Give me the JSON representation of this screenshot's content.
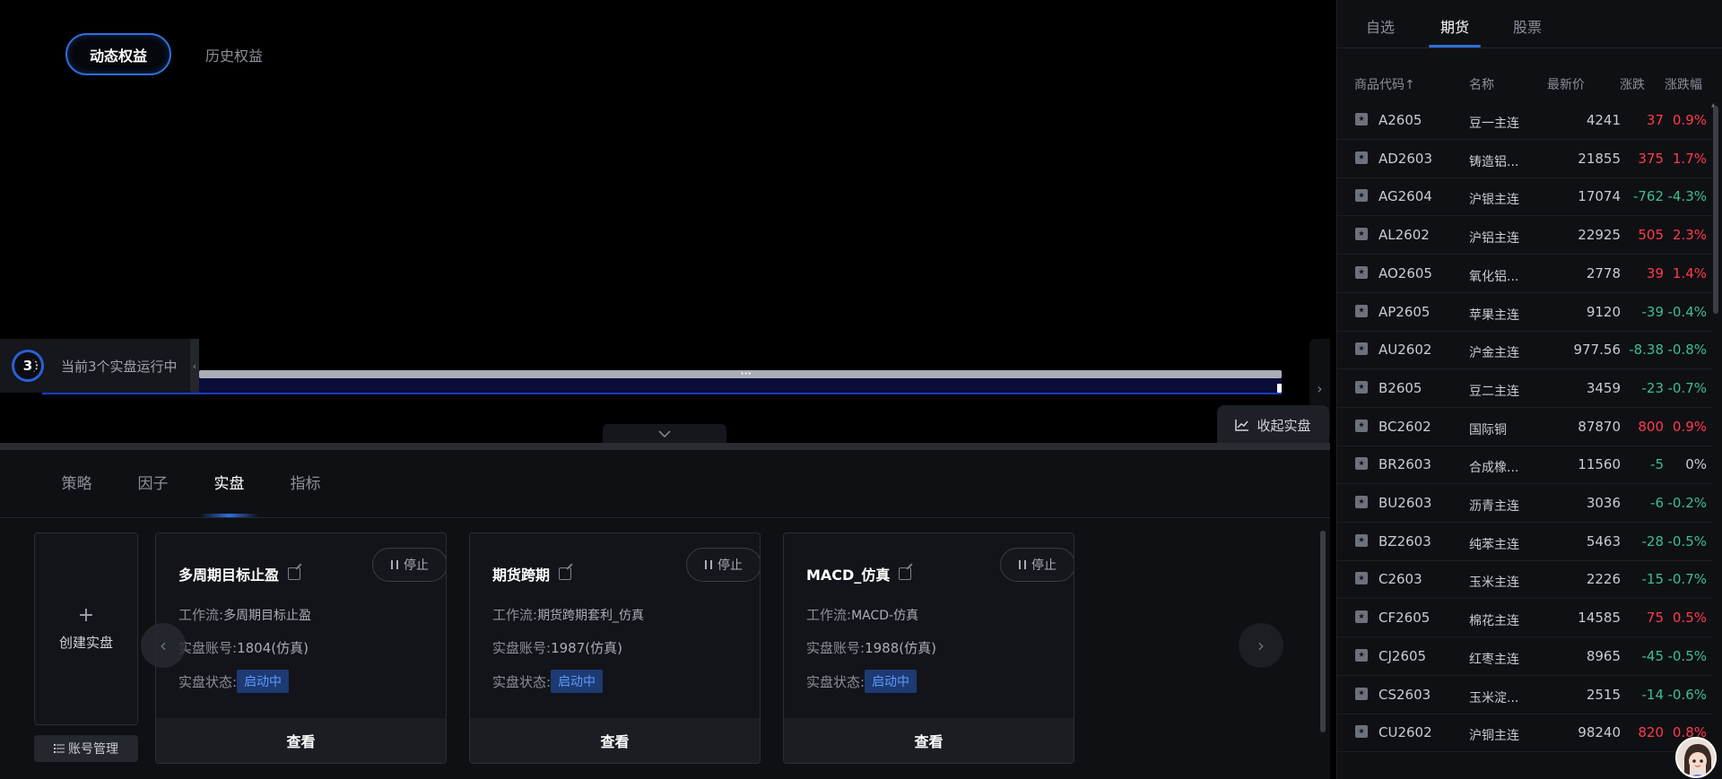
{
  "equity_tabs": [
    {
      "label": "动态权益",
      "active": true
    },
    {
      "label": "历史权益",
      "active": false
    }
  ],
  "running": {
    "count": "3",
    "text": "当前3个实盘运行中"
  },
  "collapse_live_label": "收起实盘",
  "bottom_tabs": [
    {
      "label": "策略",
      "active": false
    },
    {
      "label": "因子",
      "active": false
    },
    {
      "label": "实盘",
      "active": true
    },
    {
      "label": "指标",
      "active": false
    }
  ],
  "create_card": {
    "plus": "+",
    "label": "创建实盘"
  },
  "account_button": {
    "icon": "list-icon",
    "label": "账号管理"
  },
  "live_cards": [
    {
      "title": "多周期目标止盈",
      "stop": "停止",
      "workflow_label": "工作流:",
      "workflow": "多周期目标止盈",
      "account_label": "实盘账号:",
      "account": "1804(仿真)",
      "status_label": "实盘状态:",
      "status": "启动中",
      "view": "查看"
    },
    {
      "title": "期货跨期",
      "stop": "停止",
      "workflow_label": "工作流:",
      "workflow": "期货跨期套利_仿真",
      "account_label": "实盘账号:",
      "account": "1987(仿真)",
      "status_label": "实盘状态:",
      "status": "启动中",
      "view": "查看"
    },
    {
      "title": "MACD_仿真",
      "stop": "停止",
      "workflow_label": "工作流:",
      "workflow": "MACD-仿真",
      "account_label": "实盘账号:",
      "account": "1988(仿真)",
      "status_label": "实盘状态:",
      "status": "启动中",
      "view": "查看"
    }
  ],
  "right_tabs": [
    {
      "label": "自选",
      "active": false
    },
    {
      "label": "期货",
      "active": true
    },
    {
      "label": "股票",
      "active": false
    }
  ],
  "quote_headers": {
    "code": "商品代码↑",
    "name": "名称",
    "price": "最新价",
    "chg": "涨跌",
    "pct": "涨跌幅"
  },
  "quotes": [
    {
      "code": "A2605",
      "name": "豆一主连",
      "price": "4241",
      "chg": "37",
      "pct": "0.9%",
      "dir": "up"
    },
    {
      "code": "AD2603",
      "name": "铸造铝...",
      "price": "21855",
      "chg": "375",
      "pct": "1.7%",
      "dir": "up"
    },
    {
      "code": "AG2604",
      "name": "沪银主连",
      "price": "17074",
      "chg": "-762",
      "pct": "-4.3%",
      "dir": "down"
    },
    {
      "code": "AL2602",
      "name": "沪铝主连",
      "price": "22925",
      "chg": "505",
      "pct": "2.3%",
      "dir": "up"
    },
    {
      "code": "AO2605",
      "name": "氧化铝...",
      "price": "2778",
      "chg": "39",
      "pct": "1.4%",
      "dir": "up"
    },
    {
      "code": "AP2605",
      "name": "苹果主连",
      "price": "9120",
      "chg": "-39",
      "pct": "-0.4%",
      "dir": "down"
    },
    {
      "code": "AU2602",
      "name": "沪金主连",
      "price": "977.56",
      "chg": "-8.38",
      "pct": "-0.8%",
      "dir": "down"
    },
    {
      "code": "B2605",
      "name": "豆二主连",
      "price": "3459",
      "chg": "-23",
      "pct": "-0.7%",
      "dir": "down"
    },
    {
      "code": "BC2602",
      "name": "国际铜",
      "price": "87870",
      "chg": "800",
      "pct": "0.9%",
      "dir": "up"
    },
    {
      "code": "BR2603",
      "name": "合成橡...",
      "price": "11560",
      "chg": "-5",
      "pct": "0%",
      "dir": "down",
      "pct_dir": "flat"
    },
    {
      "code": "BU2603",
      "name": "沥青主连",
      "price": "3036",
      "chg": "-6",
      "pct": "-0.2%",
      "dir": "down"
    },
    {
      "code": "BZ2603",
      "name": "纯苯主连",
      "price": "5463",
      "chg": "-28",
      "pct": "-0.5%",
      "dir": "down"
    },
    {
      "code": "C2603",
      "name": "玉米主连",
      "price": "2226",
      "chg": "-15",
      "pct": "-0.7%",
      "dir": "down"
    },
    {
      "code": "CF2605",
      "name": "棉花主连",
      "price": "14585",
      "chg": "75",
      "pct": "0.5%",
      "dir": "up"
    },
    {
      "code": "CJ2605",
      "name": "红枣主连",
      "price": "8965",
      "chg": "-45",
      "pct": "-0.5%",
      "dir": "down"
    },
    {
      "code": "CS2603",
      "name": "玉米淀...",
      "price": "2515",
      "chg": "-14",
      "pct": "-0.6%",
      "dir": "down"
    },
    {
      "code": "CU2602",
      "name": "沪铜主连",
      "price": "98240",
      "chg": "820",
      "pct": "0.8%",
      "dir": "up"
    }
  ],
  "colors": {
    "accent": "#2f6fdc",
    "up": "#ff3b4a",
    "down": "#3dbf8f",
    "badge_bg": "#1e3a72",
    "badge_text": "#5b9bff"
  }
}
